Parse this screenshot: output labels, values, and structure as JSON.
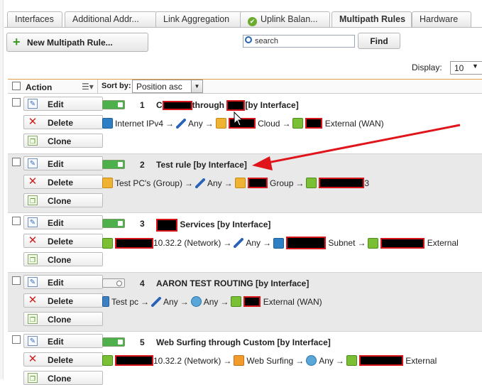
{
  "tabs": [
    {
      "label": "Interfaces"
    },
    {
      "label": "Additional Addr..."
    },
    {
      "label": "Link Aggregation"
    },
    {
      "label": "Uplink Balan..."
    },
    {
      "label": "Multipath Rules"
    },
    {
      "label": "Hardware"
    }
  ],
  "toolbar": {
    "new_rule_label": "New Multipath Rule...",
    "search_placeholder": "search",
    "find_label": "Find",
    "display_label": "Display:",
    "display_value": "10"
  },
  "table": {
    "action_label": "Action",
    "sort_by_label": "Sort by:",
    "sort_value": "Position asc"
  },
  "row_buttons": {
    "edit": "Edit",
    "delete": "Delete",
    "clone": "Clone"
  },
  "rules": [
    {
      "number": "1",
      "title_a": "C",
      "title_b": "through",
      "title_c": "[by Interface]",
      "enabled": true,
      "flow": {
        "src": "Internet IPv4",
        "svc": "Any",
        "dst_suffix": "Cloud",
        "gw_suffix": "External (WAN)"
      }
    },
    {
      "number": "2",
      "title": "Test rule [by Interface]",
      "enabled": true,
      "flow": {
        "src": "Test PC's (Group)",
        "svc": "Any",
        "dst_suffix": "Group",
        "gw_suffix": "3"
      }
    },
    {
      "number": "3",
      "title_b": "Services [by Interface]",
      "enabled": true,
      "flow": {
        "src_suffix": "10.32.2 (Network)",
        "svc": "Any",
        "dst_suffix": "Subnet",
        "gw_suffix": "External"
      }
    },
    {
      "number": "4",
      "title": "AARON TEST ROUTING [by Interface]",
      "enabled": false,
      "flow": {
        "src": "Test pc",
        "svc": "Any",
        "dst": "Any",
        "gw_suffix": "External (WAN)"
      }
    },
    {
      "number": "5",
      "title": "Web Surfing through Custom [by Interface]",
      "enabled": true,
      "flow": {
        "src_suffix": "10.32.2 (Network)",
        "svc": "Web Surfing",
        "dst": "Any",
        "gw_suffix": "External"
      }
    }
  ],
  "colors": {
    "annotation_arrow": "#e0141b",
    "redaction_border": "#d8141b",
    "enabled_toggle": "#4db04a",
    "header_accent": "#e59d4e"
  }
}
